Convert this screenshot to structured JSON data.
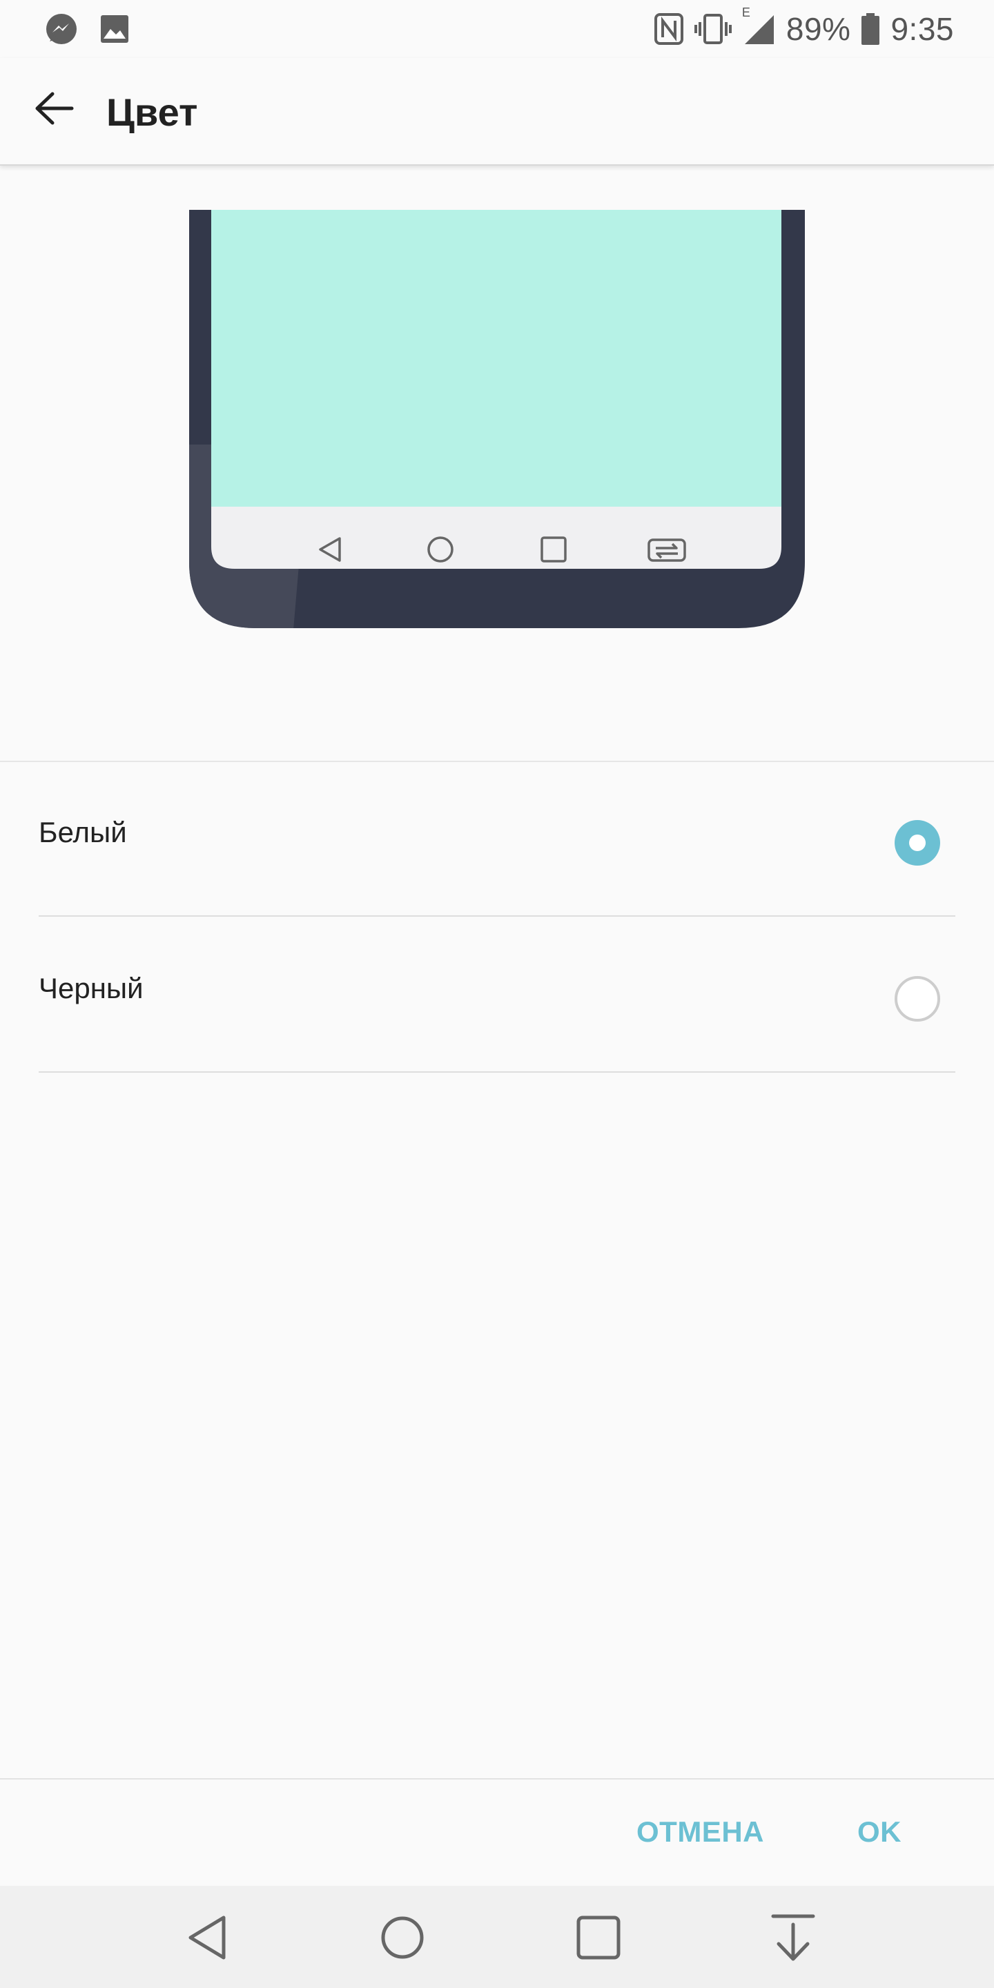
{
  "status_bar": {
    "battery_percent": "89%",
    "time": "9:35",
    "network_type": "E",
    "icons": [
      "messenger-icon",
      "gallery-icon",
      "nfc-icon",
      "vibrate-icon",
      "signal-icon",
      "battery-icon"
    ]
  },
  "app_bar": {
    "title": "Цвет"
  },
  "preview": {
    "screen_color": "#b6f2e6",
    "frame_color": "#33384a",
    "nav_bar_color": "#f0f0f2"
  },
  "options": [
    {
      "label": "Белый",
      "selected": true
    },
    {
      "label": "Черный",
      "selected": false
    }
  ],
  "actions": {
    "cancel_label": "ОТМЕНА",
    "ok_label": "OK"
  },
  "colors": {
    "accent": "#6cc0d3"
  }
}
